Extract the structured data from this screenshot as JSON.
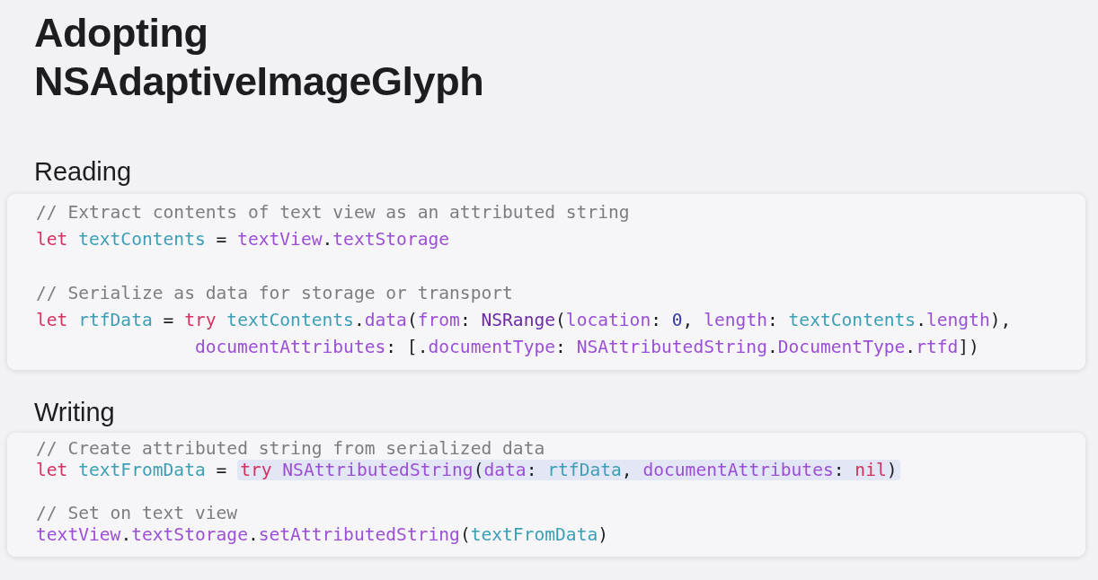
{
  "title_lines": [
    "Adopting",
    "NSAdaptiveImageGlyph"
  ],
  "sections": [
    {
      "heading": "Reading",
      "lines": [
        {
          "kind": "code",
          "tokens": [
            {
              "t": "// Extract contents of text view as an attributed string",
              "kind": "comment"
            }
          ]
        },
        {
          "kind": "code",
          "tokens": [
            {
              "t": "let ",
              "kind": "keyword"
            },
            {
              "t": "textContents",
              "kind": "ident"
            },
            {
              "t": " = ",
              "kind": "plain"
            },
            {
              "t": "textView",
              "kind": "member"
            },
            {
              "t": ".",
              "kind": "plain"
            },
            {
              "t": "textStorage",
              "kind": "member"
            }
          ]
        },
        {
          "kind": "blank"
        },
        {
          "kind": "code",
          "tokens": [
            {
              "t": "// Serialize as data for storage or transport",
              "kind": "comment"
            }
          ]
        },
        {
          "kind": "code",
          "tokens": [
            {
              "t": "let ",
              "kind": "keyword"
            },
            {
              "t": "rtfData",
              "kind": "ident"
            },
            {
              "t": " = ",
              "kind": "plain"
            },
            {
              "t": "try ",
              "kind": "keyword"
            },
            {
              "t": "textContents",
              "kind": "ident"
            },
            {
              "t": ".",
              "kind": "plain"
            },
            {
              "t": "data",
              "kind": "member"
            },
            {
              "t": "(",
              "kind": "plain"
            },
            {
              "t": "from",
              "kind": "member"
            },
            {
              "t": ": ",
              "kind": "plain"
            },
            {
              "t": "NSRange",
              "kind": "type"
            },
            {
              "t": "(",
              "kind": "plain"
            },
            {
              "t": "location",
              "kind": "member"
            },
            {
              "t": ": ",
              "kind": "plain"
            },
            {
              "t": "0",
              "kind": "number"
            },
            {
              "t": ", ",
              "kind": "plain"
            },
            {
              "t": "length",
              "kind": "member"
            },
            {
              "t": ": ",
              "kind": "plain"
            },
            {
              "t": "textContents",
              "kind": "ident"
            },
            {
              "t": ".",
              "kind": "plain"
            },
            {
              "t": "length",
              "kind": "member"
            },
            {
              "t": "),",
              "kind": "plain"
            }
          ]
        },
        {
          "kind": "continuation",
          "tokens": [
            {
              "t": "documentAttributes",
              "kind": "member"
            },
            {
              "t": ": [.",
              "kind": "plain"
            },
            {
              "t": "documentType",
              "kind": "member"
            },
            {
              "t": ": ",
              "kind": "plain"
            },
            {
              "t": "NSAttributedString",
              "kind": "member"
            },
            {
              "t": ".",
              "kind": "plain"
            },
            {
              "t": "DocumentType",
              "kind": "member"
            },
            {
              "t": ".",
              "kind": "plain"
            },
            {
              "t": "rtfd",
              "kind": "member"
            },
            {
              "t": "])",
              "kind": "plain"
            }
          ]
        }
      ]
    },
    {
      "heading": "Writing",
      "lines": [
        {
          "kind": "code",
          "tokens": [
            {
              "t": "// Create attributed string from serialized data",
              "kind": "comment"
            }
          ]
        },
        {
          "kind": "code",
          "tokens": [
            {
              "t": "let ",
              "kind": "keyword"
            },
            {
              "t": "textFromData",
              "kind": "ident"
            },
            {
              "t": " = ",
              "kind": "plain"
            }
          ],
          "highlighted_tokens": [
            {
              "t": "try ",
              "kind": "keyword"
            },
            {
              "t": "NSAttributedString",
              "kind": "member"
            },
            {
              "t": "(",
              "kind": "plain"
            },
            {
              "t": "data",
              "kind": "member"
            },
            {
              "t": ": ",
              "kind": "plain"
            },
            {
              "t": "rtfData",
              "kind": "ident"
            },
            {
              "t": ", ",
              "kind": "plain"
            },
            {
              "t": "documentAttributes",
              "kind": "member"
            },
            {
              "t": ": ",
              "kind": "plain"
            },
            {
              "t": "nil",
              "kind": "keyword"
            },
            {
              "t": ")",
              "kind": "plain"
            }
          ]
        },
        {
          "kind": "blank"
        },
        {
          "kind": "code",
          "tokens": [
            {
              "t": "// Set on text view",
              "kind": "comment"
            }
          ]
        },
        {
          "kind": "code",
          "tokens": [
            {
              "t": "textView",
              "kind": "member"
            },
            {
              "t": ".",
              "kind": "plain"
            },
            {
              "t": "textStorage",
              "kind": "member"
            },
            {
              "t": ".",
              "kind": "plain"
            },
            {
              "t": "setAttributedString",
              "kind": "member"
            },
            {
              "t": "(",
              "kind": "plain"
            },
            {
              "t": "textFromData",
              "kind": "ident"
            },
            {
              "t": ")",
              "kind": "plain"
            }
          ]
        }
      ]
    }
  ]
}
